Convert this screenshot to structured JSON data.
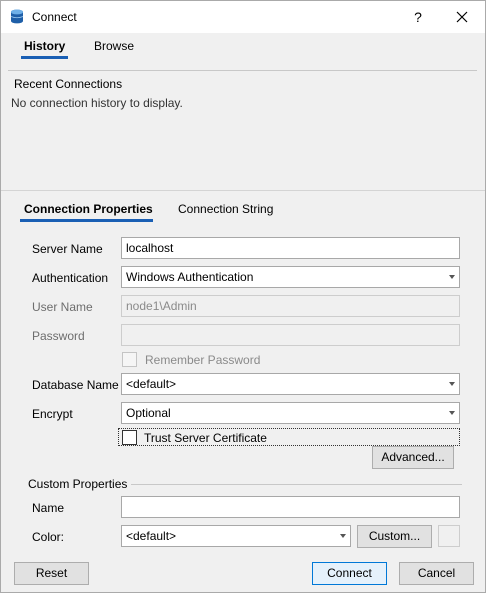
{
  "window": {
    "title": "Connect",
    "help_glyph": "?",
    "close_glyph": "✕"
  },
  "history_tabs": [
    {
      "label": "History",
      "active": true
    },
    {
      "label": "Browse",
      "active": false
    }
  ],
  "recent": {
    "heading": "Recent Connections",
    "empty_text": "No connection history to display."
  },
  "props_tabs": [
    {
      "label": "Connection Properties",
      "active": true
    },
    {
      "label": "Connection String",
      "active": false
    }
  ],
  "form": {
    "server_name": {
      "label": "Server Name",
      "value": "localhost"
    },
    "authentication": {
      "label": "Authentication",
      "value": "Windows Authentication"
    },
    "user_name": {
      "label": "User Name",
      "value": "node1\\Admin"
    },
    "password": {
      "label": "Password",
      "value": ""
    },
    "remember_password": {
      "label": "Remember Password",
      "checked": false
    },
    "database_name": {
      "label": "Database Name",
      "value": "<default>"
    },
    "encrypt": {
      "label": "Encrypt",
      "value": "Optional"
    },
    "trust_server_certificate": {
      "label": "Trust Server Certificate",
      "checked": false
    },
    "advanced_label": "Advanced..."
  },
  "custom": {
    "group_label": "Custom Properties",
    "name": {
      "label": "Name",
      "value": ""
    },
    "color": {
      "label": "Color:",
      "value": "<default>"
    },
    "custom_button": "Custom..."
  },
  "footer": {
    "reset": "Reset",
    "connect": "Connect",
    "cancel": "Cancel"
  },
  "colors": {
    "accent": "#1a5fb4",
    "primary_border": "#0078d7",
    "panel_bg": "#f0f0f0"
  }
}
